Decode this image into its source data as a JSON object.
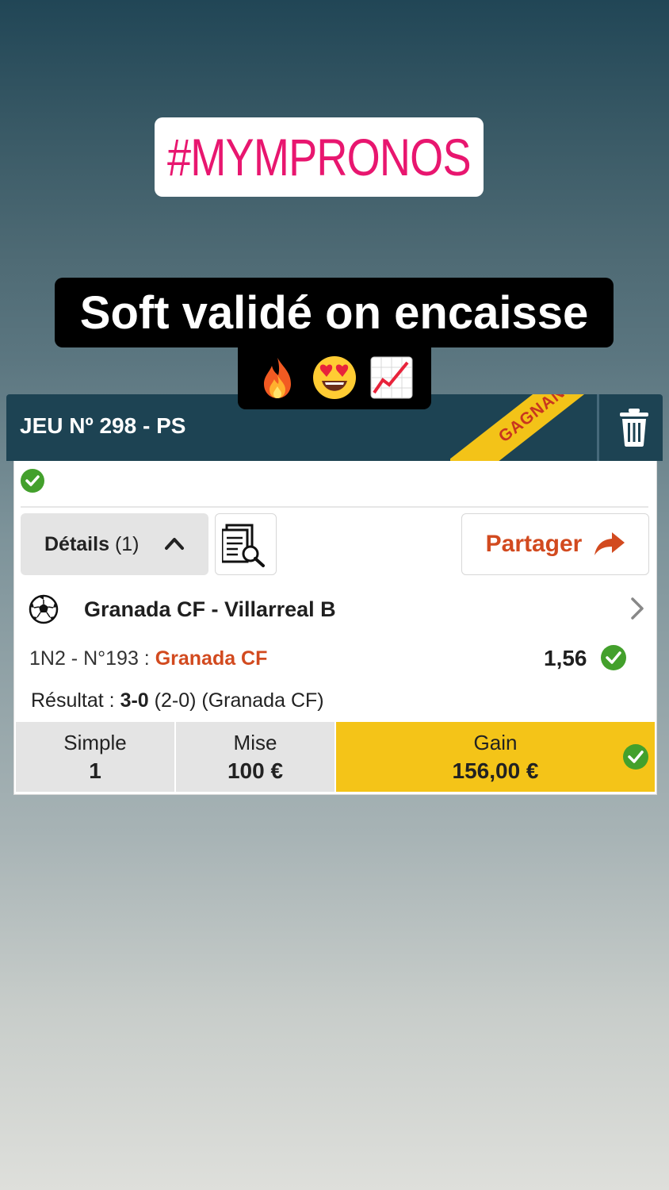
{
  "story": {
    "hashtag": "#MYMPRONOS",
    "caption": "Soft validé on encaisse",
    "emojis": [
      "fire-emoji",
      "heart-eyes-emoji",
      "chart-increasing-emoji"
    ]
  },
  "bet": {
    "title": "JEU Nº 298 - PS",
    "status": "GAGNANT",
    "details_label": "Détails",
    "details_count": "(1)",
    "share_label": "Partager",
    "match": "Granada CF - Villarreal B",
    "pick_prefix": "1N2 - N°193 : ",
    "pick_team": "Granada CF",
    "odd": "1,56",
    "result_prefix": "Résultat : ",
    "result_score": "3-0",
    "result_suffix": " (2-0) (Granada CF)",
    "type_label": "Simple",
    "type_value": "1",
    "stake_label": "Mise",
    "stake_value": "100 €",
    "gain_label": "Gain",
    "gain_value": "156,00 €"
  },
  "colors": {
    "header_bg": "#1d4353",
    "accent_orange": "#d24a1f",
    "gain_yellow": "#f4c418",
    "check_green": "#43a02c",
    "hashtag_pink": "#e8166f"
  }
}
